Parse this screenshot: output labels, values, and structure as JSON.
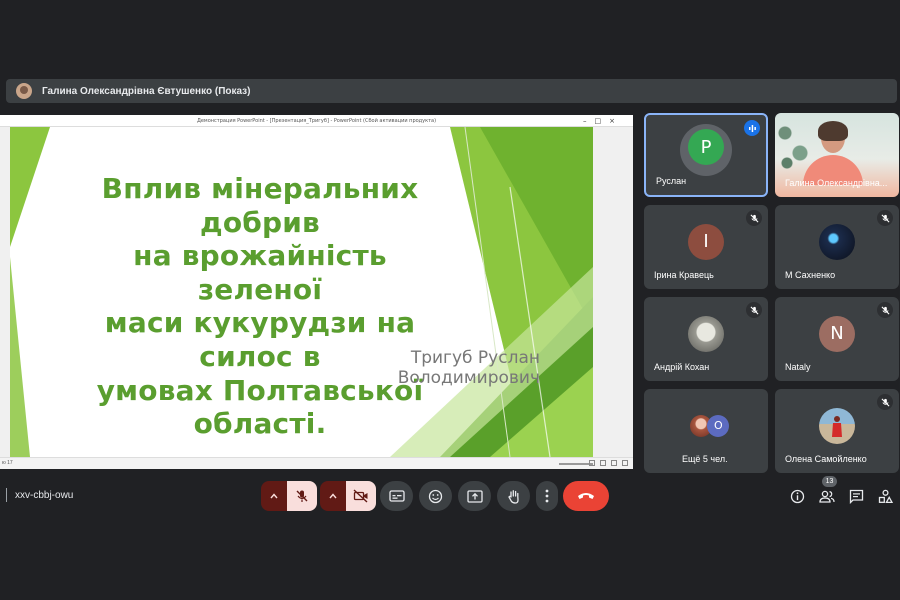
{
  "presenter_bar": {
    "name": "Галина Олександрівна Євтушенко (Показ)"
  },
  "shared_window": {
    "title": "Демонстрация PowerPoint - [Презентация_Тригуб] - PowerPoint (Сбой активации продукта)",
    "slide_title": "Вплив мінеральних добрив\nна врожайність зеленої\nмаси кукурудзи на силос в\nумовах Полтавської\nобласті.",
    "slide_author": "Тригуб Руслан\nВолодимирович",
    "status_text": "ю 17",
    "accent_colors": {
      "green": "#8cc63f",
      "dark_green": "#5a9e2f"
    }
  },
  "participants": [
    {
      "name": "Руслан",
      "initial": "P",
      "avatar_color": "#34a853",
      "state": "speaking"
    },
    {
      "name": "Галина Олександрівна...",
      "state": "video"
    },
    {
      "name": "Ірина Кравець",
      "initial": "I",
      "avatar_color": "#8d4d3f",
      "state": "muted"
    },
    {
      "name": "М Сахненко",
      "state": "muted",
      "avatar": "galaxy-image"
    },
    {
      "name": "Андрій Кохан",
      "state": "muted",
      "avatar": "robot-image"
    },
    {
      "name": "Nataly",
      "initial": "N",
      "avatar_color": "#9c6d62",
      "state": "muted"
    },
    {
      "name": "Ещё 5 чел.",
      "extra_initial": "O",
      "extra_color": "#5c6bc0"
    },
    {
      "name": "Олена Самойленко",
      "state": "muted",
      "avatar": "red-figure-image"
    }
  ],
  "meeting": {
    "code": "xxv-cbbj-owu",
    "participant_count": "13"
  },
  "colors": {
    "background": "#202124",
    "tile": "#3c4043",
    "end_call": "#ea4335",
    "mic_off_bg": "#f9dedc",
    "caret_bg": "#611a15",
    "active_border": "#8ab4f8"
  }
}
